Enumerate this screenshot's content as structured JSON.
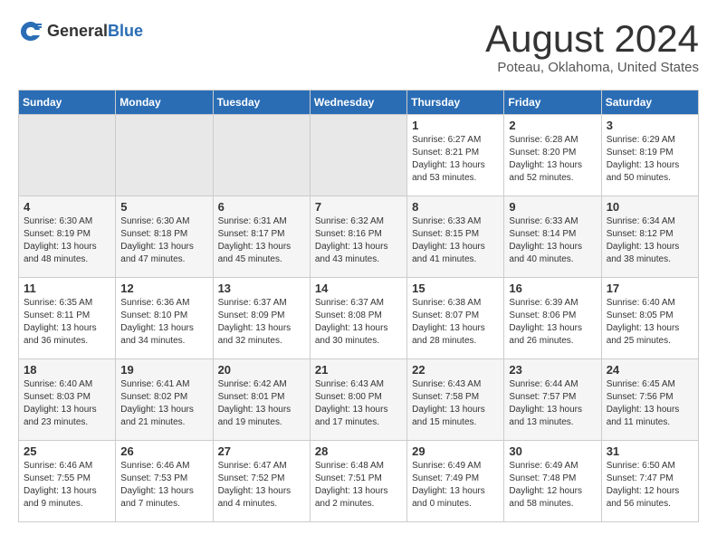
{
  "logo": {
    "general": "General",
    "blue": "Blue"
  },
  "title": "August 2024",
  "subtitle": "Poteau, Oklahoma, United States",
  "days_of_week": [
    "Sunday",
    "Monday",
    "Tuesday",
    "Wednesday",
    "Thursday",
    "Friday",
    "Saturday"
  ],
  "weeks": [
    [
      {
        "day": "",
        "info": ""
      },
      {
        "day": "",
        "info": ""
      },
      {
        "day": "",
        "info": ""
      },
      {
        "day": "",
        "info": ""
      },
      {
        "day": "1",
        "info": "Sunrise: 6:27 AM\nSunset: 8:21 PM\nDaylight: 13 hours\nand 53 minutes."
      },
      {
        "day": "2",
        "info": "Sunrise: 6:28 AM\nSunset: 8:20 PM\nDaylight: 13 hours\nand 52 minutes."
      },
      {
        "day": "3",
        "info": "Sunrise: 6:29 AM\nSunset: 8:19 PM\nDaylight: 13 hours\nand 50 minutes."
      }
    ],
    [
      {
        "day": "4",
        "info": "Sunrise: 6:30 AM\nSunset: 8:19 PM\nDaylight: 13 hours\nand 48 minutes."
      },
      {
        "day": "5",
        "info": "Sunrise: 6:30 AM\nSunset: 8:18 PM\nDaylight: 13 hours\nand 47 minutes."
      },
      {
        "day": "6",
        "info": "Sunrise: 6:31 AM\nSunset: 8:17 PM\nDaylight: 13 hours\nand 45 minutes."
      },
      {
        "day": "7",
        "info": "Sunrise: 6:32 AM\nSunset: 8:16 PM\nDaylight: 13 hours\nand 43 minutes."
      },
      {
        "day": "8",
        "info": "Sunrise: 6:33 AM\nSunset: 8:15 PM\nDaylight: 13 hours\nand 41 minutes."
      },
      {
        "day": "9",
        "info": "Sunrise: 6:33 AM\nSunset: 8:14 PM\nDaylight: 13 hours\nand 40 minutes."
      },
      {
        "day": "10",
        "info": "Sunrise: 6:34 AM\nSunset: 8:12 PM\nDaylight: 13 hours\nand 38 minutes."
      }
    ],
    [
      {
        "day": "11",
        "info": "Sunrise: 6:35 AM\nSunset: 8:11 PM\nDaylight: 13 hours\nand 36 minutes."
      },
      {
        "day": "12",
        "info": "Sunrise: 6:36 AM\nSunset: 8:10 PM\nDaylight: 13 hours\nand 34 minutes."
      },
      {
        "day": "13",
        "info": "Sunrise: 6:37 AM\nSunset: 8:09 PM\nDaylight: 13 hours\nand 32 minutes."
      },
      {
        "day": "14",
        "info": "Sunrise: 6:37 AM\nSunset: 8:08 PM\nDaylight: 13 hours\nand 30 minutes."
      },
      {
        "day": "15",
        "info": "Sunrise: 6:38 AM\nSunset: 8:07 PM\nDaylight: 13 hours\nand 28 minutes."
      },
      {
        "day": "16",
        "info": "Sunrise: 6:39 AM\nSunset: 8:06 PM\nDaylight: 13 hours\nand 26 minutes."
      },
      {
        "day": "17",
        "info": "Sunrise: 6:40 AM\nSunset: 8:05 PM\nDaylight: 13 hours\nand 25 minutes."
      }
    ],
    [
      {
        "day": "18",
        "info": "Sunrise: 6:40 AM\nSunset: 8:03 PM\nDaylight: 13 hours\nand 23 minutes."
      },
      {
        "day": "19",
        "info": "Sunrise: 6:41 AM\nSunset: 8:02 PM\nDaylight: 13 hours\nand 21 minutes."
      },
      {
        "day": "20",
        "info": "Sunrise: 6:42 AM\nSunset: 8:01 PM\nDaylight: 13 hours\nand 19 minutes."
      },
      {
        "day": "21",
        "info": "Sunrise: 6:43 AM\nSunset: 8:00 PM\nDaylight: 13 hours\nand 17 minutes."
      },
      {
        "day": "22",
        "info": "Sunrise: 6:43 AM\nSunset: 7:58 PM\nDaylight: 13 hours\nand 15 minutes."
      },
      {
        "day": "23",
        "info": "Sunrise: 6:44 AM\nSunset: 7:57 PM\nDaylight: 13 hours\nand 13 minutes."
      },
      {
        "day": "24",
        "info": "Sunrise: 6:45 AM\nSunset: 7:56 PM\nDaylight: 13 hours\nand 11 minutes."
      }
    ],
    [
      {
        "day": "25",
        "info": "Sunrise: 6:46 AM\nSunset: 7:55 PM\nDaylight: 13 hours\nand 9 minutes."
      },
      {
        "day": "26",
        "info": "Sunrise: 6:46 AM\nSunset: 7:53 PM\nDaylight: 13 hours\nand 7 minutes."
      },
      {
        "day": "27",
        "info": "Sunrise: 6:47 AM\nSunset: 7:52 PM\nDaylight: 13 hours\nand 4 minutes."
      },
      {
        "day": "28",
        "info": "Sunrise: 6:48 AM\nSunset: 7:51 PM\nDaylight: 13 hours\nand 2 minutes."
      },
      {
        "day": "29",
        "info": "Sunrise: 6:49 AM\nSunset: 7:49 PM\nDaylight: 13 hours\nand 0 minutes."
      },
      {
        "day": "30",
        "info": "Sunrise: 6:49 AM\nSunset: 7:48 PM\nDaylight: 12 hours\nand 58 minutes."
      },
      {
        "day": "31",
        "info": "Sunrise: 6:50 AM\nSunset: 7:47 PM\nDaylight: 12 hours\nand 56 minutes."
      }
    ]
  ]
}
